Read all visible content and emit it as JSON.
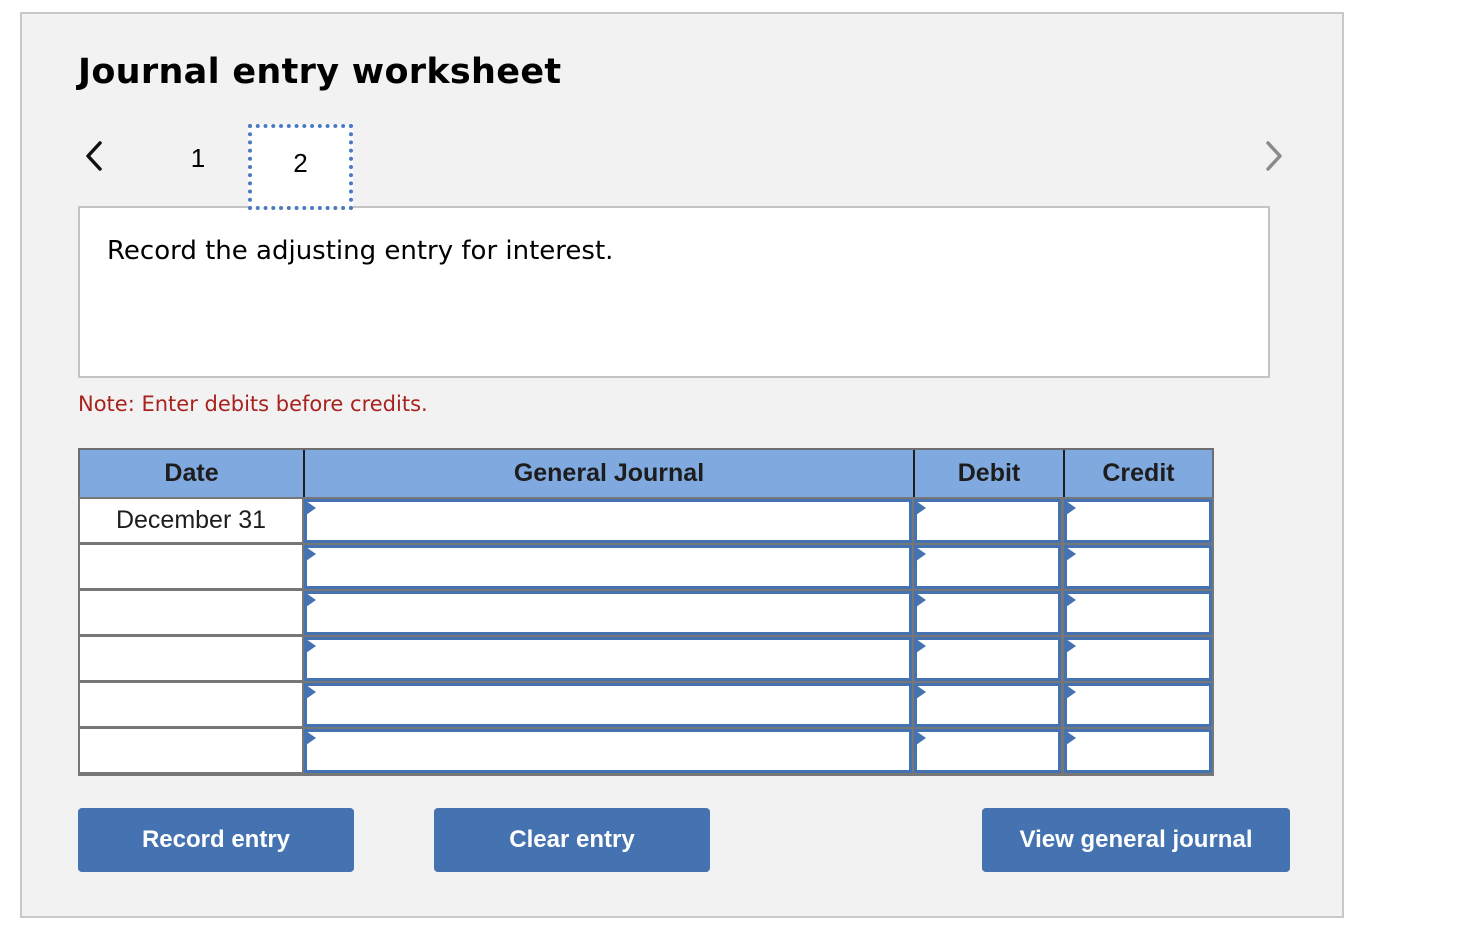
{
  "worksheet": {
    "title": "Journal entry worksheet",
    "nav": {
      "prev_icon": "chevron-left-icon",
      "next_icon": "chevron-right-icon",
      "tabs": [
        {
          "label": "1",
          "active": false
        },
        {
          "label": "2",
          "active": true
        }
      ]
    },
    "prompt": "Record the adjusting entry for interest.",
    "note": "Note: Enter debits before credits.",
    "colors": {
      "accent": "#4573b1",
      "header_bg": "#80a9df",
      "note_text": "#a8231f",
      "panel_bg": "#f2f2f2"
    }
  },
  "journal": {
    "columns": [
      "Date",
      "General Journal",
      "Debit",
      "Credit"
    ],
    "rows": [
      {
        "date": "December 31",
        "account": "",
        "debit": "",
        "credit": ""
      },
      {
        "date": "",
        "account": "",
        "debit": "",
        "credit": ""
      },
      {
        "date": "",
        "account": "",
        "debit": "",
        "credit": ""
      },
      {
        "date": "",
        "account": "",
        "debit": "",
        "credit": ""
      },
      {
        "date": "",
        "account": "",
        "debit": "",
        "credit": ""
      },
      {
        "date": "",
        "account": "",
        "debit": "",
        "credit": ""
      }
    ]
  },
  "buttons": {
    "record": "Record entry",
    "clear": "Clear entry",
    "view": "View general journal"
  }
}
